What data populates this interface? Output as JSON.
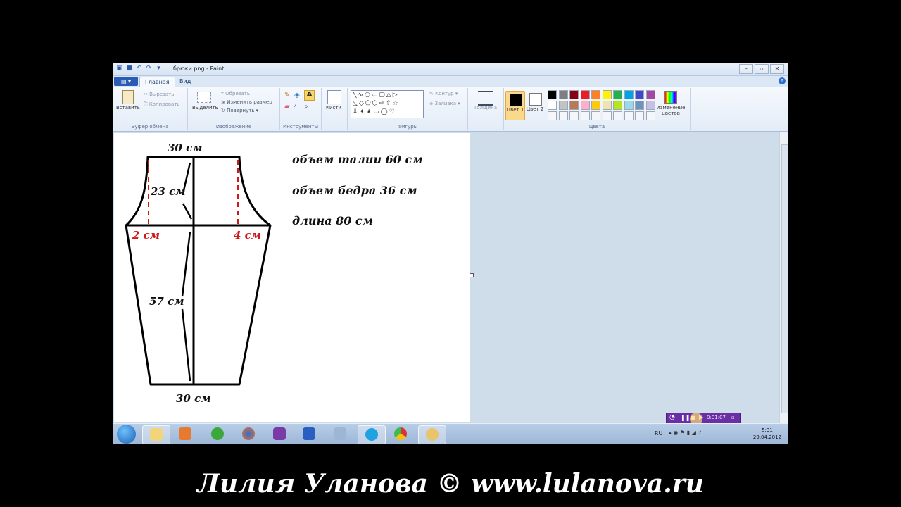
{
  "window": {
    "title": "брюки.png - Paint",
    "tabs": [
      "Главная",
      "Вид"
    ],
    "active_tab": "Главная"
  },
  "ribbon": {
    "clipboard": {
      "paste": "Вставить",
      "cut": "Вырезать",
      "copy": "Копировать",
      "group": "Буфер обмена"
    },
    "image": {
      "select": "Выделить",
      "crop": "Обрезать",
      "resize": "Изменить размер",
      "rotate": "Повернуть",
      "group": "Изображение"
    },
    "tools": {
      "group": "Инструменты"
    },
    "brushes": {
      "label": "Кисти"
    },
    "shapes": {
      "outline": "Контур",
      "fill": "Заливка",
      "group": "Фигуры"
    },
    "thickness": {
      "label": "Толщина"
    },
    "colors": {
      "color1": "Цвет 1",
      "color2": "Цвет 2",
      "edit": "Изменение цветов",
      "group": "Цвета",
      "color1_value": "#000000",
      "color2_value": "#ffffff",
      "palette": [
        "#000000",
        "#7f7f7f",
        "#880015",
        "#ed1c24",
        "#ff7f27",
        "#fff200",
        "#22b14c",
        "#00a2e8",
        "#3f48cc",
        "#a349a4",
        "#ffffff",
        "#c3c3c3",
        "#b97a57",
        "#ffaec9",
        "#ffc90e",
        "#efe4b0",
        "#b5e61d",
        "#99d9ea",
        "#7092be",
        "#c8bfe7"
      ]
    }
  },
  "drawing": {
    "top_width": "30 см",
    "rise": "23 см",
    "left_ext": "2 см",
    "right_ext": "4 см",
    "inseam": "57 см",
    "bottom_width": "30 см",
    "notes": [
      "объем талии 60 см",
      "объем бедра 36 см",
      "длина 80 см"
    ]
  },
  "recorder": {
    "time": "0:01:07"
  },
  "taskbar": {
    "lang": "RU",
    "time": "5:31",
    "date": "29.04.2012"
  },
  "credit": "Лилия Уланова © www.lulanova.ru"
}
